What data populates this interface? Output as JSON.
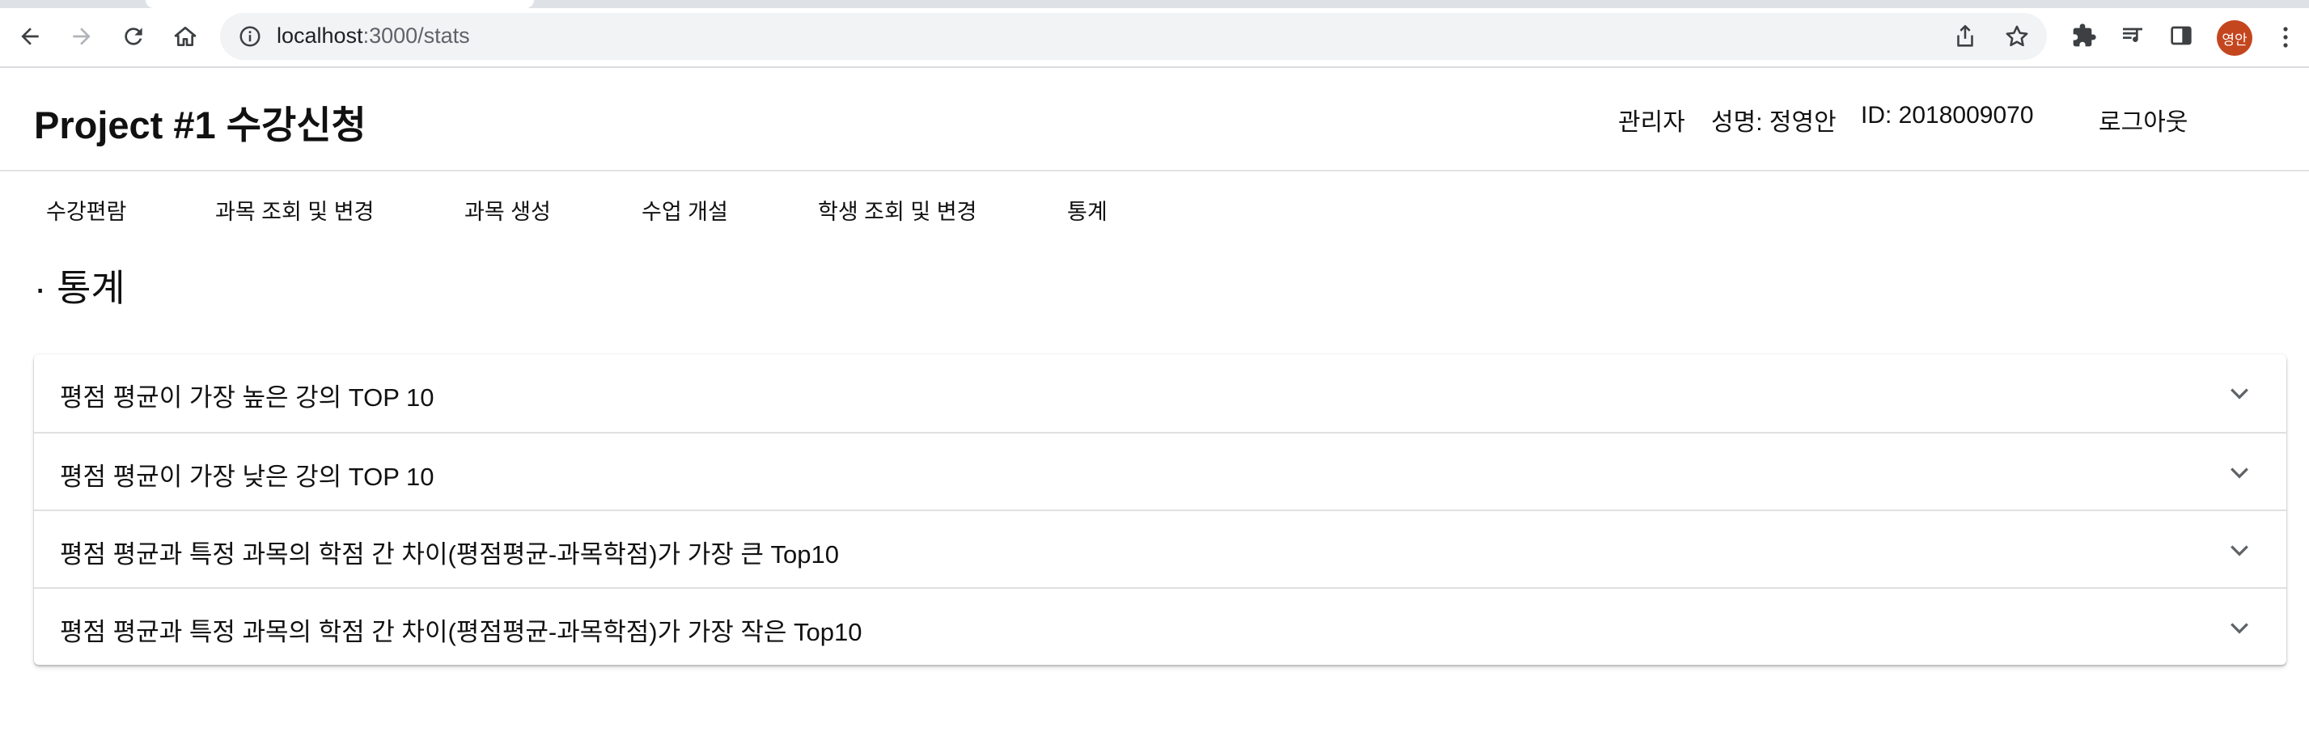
{
  "browser": {
    "url_host": "localhost",
    "url_path": ":3000/stats",
    "avatar_text": "영안",
    "icons": [
      "back-icon",
      "forward-icon",
      "reload-icon",
      "home-icon",
      "info-icon",
      "share-icon",
      "star-icon",
      "extensions-icon",
      "media-icon",
      "sidepanel-icon",
      "menu-icon"
    ]
  },
  "header": {
    "title": "Project #1 수강신청",
    "role": "관리자",
    "name": "성명: 정영안",
    "id": "ID: 2018009070",
    "logout_label": "로그아웃"
  },
  "menu": {
    "items": [
      {
        "label": "수강편람"
      },
      {
        "label": "과목 조회 및 변경"
      },
      {
        "label": "과목 생성"
      },
      {
        "label": "수업 개설"
      },
      {
        "label": "학생 조회 및 변경"
      },
      {
        "label": "통계"
      }
    ]
  },
  "section": {
    "title": "· 통계"
  },
  "accordion": {
    "items": [
      {
        "label": "평점 평균이 가장 높은 강의 TOP 10"
      },
      {
        "label": "평점 평균이 가장 낮은 강의 TOP 10"
      },
      {
        "label": "평점 평균과 특정 과목의 학점 간 차이(평점평균-과목학점)가 가장 큰 Top10"
      },
      {
        "label": "평점 평균과 특정 과목의 학점 간 차이(평점평균-과목학점)가 가장 작은 Top10"
      }
    ]
  },
  "colors": {
    "avatar_bg": "#c4461e",
    "omnibox_bg": "#f1f3f4",
    "text": "#111111"
  }
}
